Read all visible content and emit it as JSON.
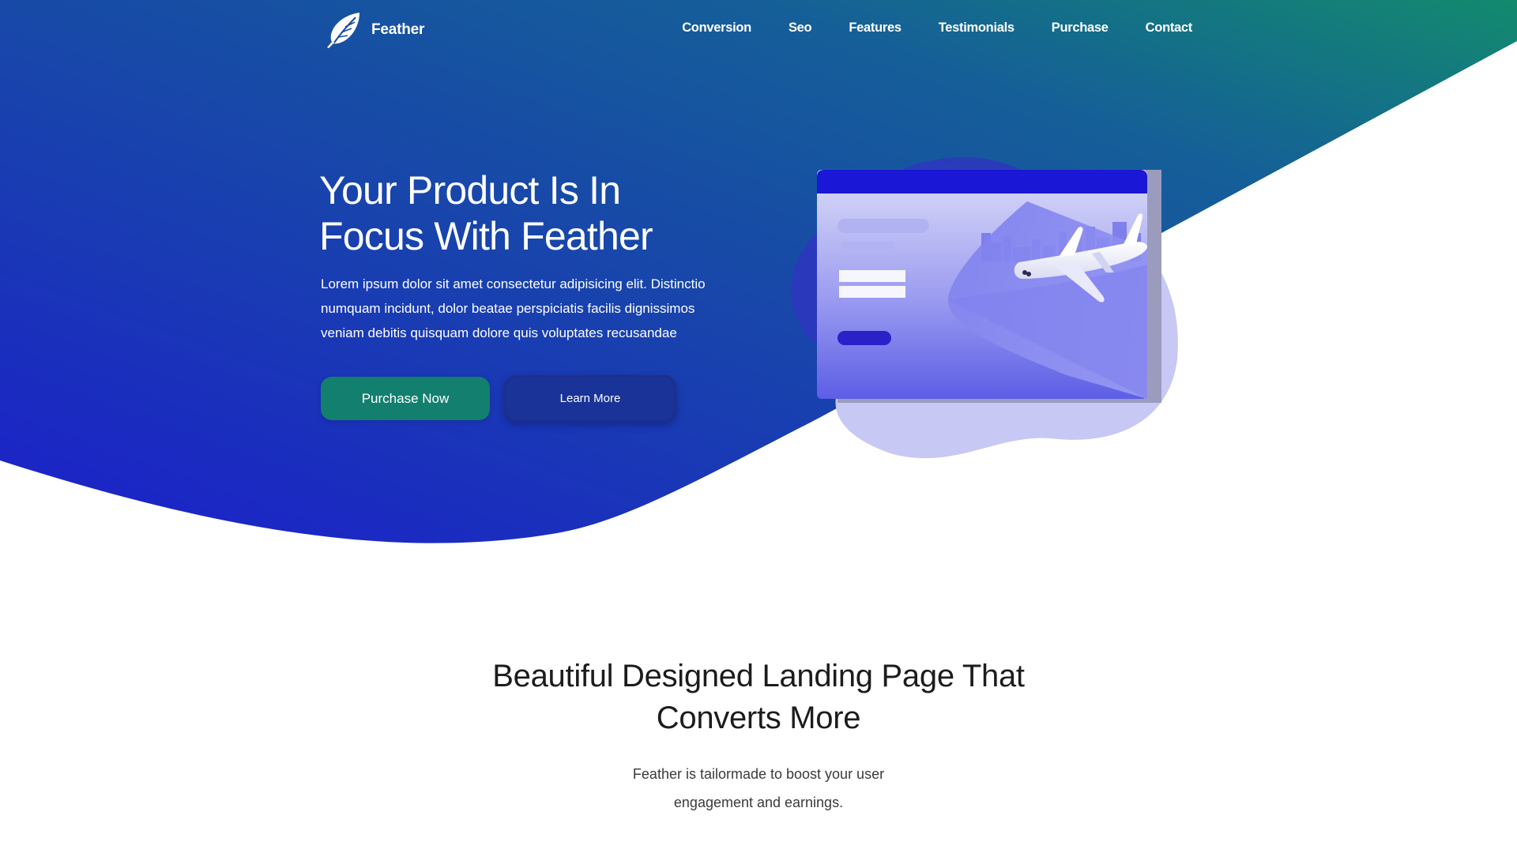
{
  "brand": {
    "name": "Feather",
    "icon": "feather-icon"
  },
  "nav": {
    "items": [
      "Conversion",
      "Seo",
      "Features",
      "Testimonials",
      "Purchase",
      "Contact"
    ]
  },
  "hero": {
    "title": "Your Product Is In Focus With Feather",
    "description": "Lorem ipsum dolor sit amet consectetur adipisicing elit. Distinctio numquam incidunt, dolor beatae perspiciatis facilis dignissimos veniam debitis quisquam dolore quis voluptates recusandae",
    "primary_button": "Purchase Now",
    "secondary_button": "Learn More",
    "illustration_icon": "airplane-browser-illustration"
  },
  "features_intro": {
    "title": "Beautiful Designed Landing Page That Converts More",
    "description": "Feather is tailormade to boost your user engagement and earnings."
  },
  "colors": {
    "hero_gradient_start": "#1c1fcb",
    "hero_gradient_end": "#138a6e",
    "primary_button": "#137f6e",
    "secondary_button": "#1a3398",
    "window_titlebar": "#1a18d6",
    "illustration_blob_light": "#c7c8f3",
    "illustration_blob_dark": "#2e36c0"
  }
}
